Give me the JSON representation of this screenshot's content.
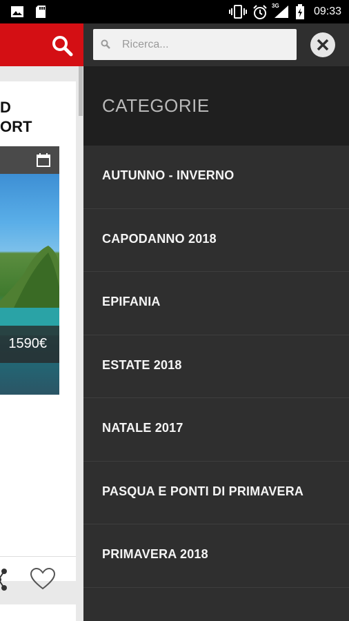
{
  "status_bar": {
    "time": "09:33",
    "network": "3G",
    "icons": [
      "image-icon",
      "sd-card-icon",
      "vibrate-icon",
      "alarm-icon",
      "signal-icon",
      "battery-charging-icon"
    ]
  },
  "background_app": {
    "card_title": "D\nORT",
    "price": "1590€",
    "brand_color": "#d40f14"
  },
  "drawer": {
    "search": {
      "placeholder": "Ricerca..."
    },
    "categories_title": "CATEGORIE",
    "categories": [
      {
        "label": "AUTUNNO - INVERNO"
      },
      {
        "label": "CAPODANNO 2018"
      },
      {
        "label": "EPIFANIA"
      },
      {
        "label": "ESTATE 2018"
      },
      {
        "label": "NATALE 2017"
      },
      {
        "label": "PASQUA E PONTI DI PRIMAVERA"
      },
      {
        "label": "PRIMAVERA 2018"
      }
    ]
  }
}
